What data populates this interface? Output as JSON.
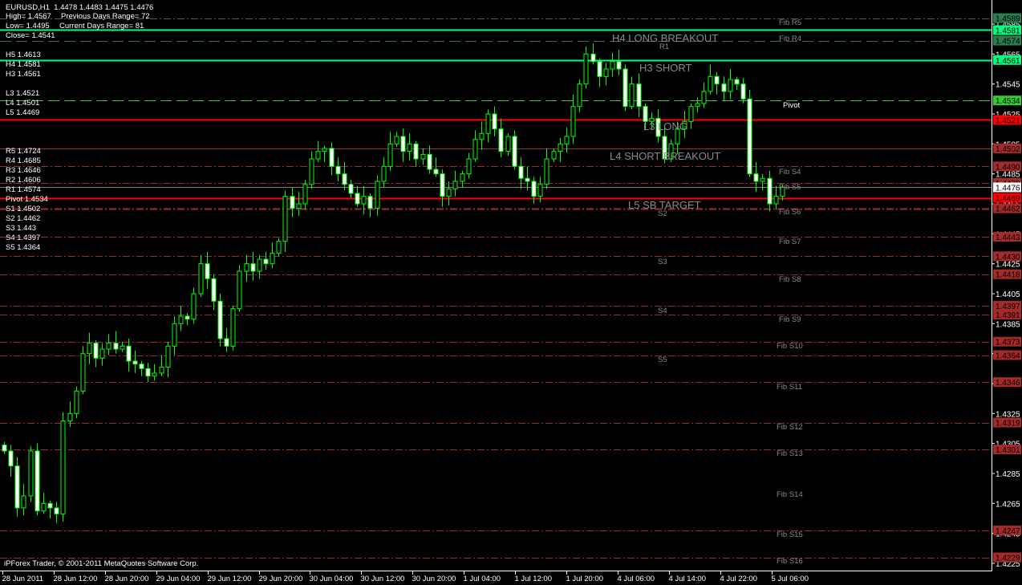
{
  "header": {
    "symbol_line": "EURUSD,H1  1.4478 1.4483 1.4475 1.4476",
    "high": "High= 1.4567",
    "prev_range": "Previous Days Range= 72",
    "low": "Low= 1.4495",
    "curr_range": "Current Days Range= 81",
    "close": "Close= 1.4541"
  },
  "levels_info": [
    "H5 1.4613",
    "H4 1.4581",
    "H3 1.4561",
    "L3 1.4521",
    "L4 1.4501",
    "L5 1.4469",
    "R5 1.4724",
    "R4 1.4685",
    "R3 1.4646",
    "R2 1.4606",
    "R1 1.4574",
    "Pivot 1.4534",
    "S1 1.4502",
    "S2 1.4462",
    "S3 1.443",
    "S4 1.4397",
    "S5 1.4364"
  ],
  "chart_labels": {
    "fib_r5": "Fib R5",
    "fib_r4": "Fib R4",
    "h4": "H4 LONG BREAKOUT",
    "r1": "R1",
    "h3": "H3 SHORT",
    "pivot": "Pivot",
    "l3": "L3 LONG",
    "l4": "L4 SHORT BREAKOUT",
    "fib_s4": "Fib S4",
    "fib_s5": "Fib S5",
    "l5": "L5 SB TARGET",
    "s2": "S2",
    "fib_s6": "Fib S6",
    "fib_s7": "Fib S7",
    "s3": "S3",
    "fib_s8": "Fib S8",
    "s4": "S4",
    "fib_s9": "Fib S9",
    "fib_s10": "Fib S10",
    "s5": "S5",
    "fib_s11": "Fib S11",
    "fib_s12": "Fib S12",
    "fib_s13": "Fib S13",
    "fib_s14": "Fib S14",
    "fib_s15": "Fib S15",
    "fib_s16": "Fib S16"
  },
  "copyright": "iPForex Trader, © 2001-2011 MetaQuotes Software Corp.",
  "chart_data": {
    "type": "candlestick",
    "symbol": "EURUSD",
    "timeframe": "H1",
    "ylim": [
      1.422,
      1.46
    ],
    "y_ticks": [
      "1.4585",
      "1.4565",
      "1.4545",
      "1.4525",
      "1.4505",
      "1.4485",
      "1.4465",
      "1.4445",
      "1.4425",
      "1.4405",
      "1.4385",
      "1.4365",
      "1.4345",
      "1.4325",
      "1.4305",
      "1.4285",
      "1.4265",
      "1.4245",
      "1.4225"
    ],
    "x_ticks": [
      "28 Jun 2011",
      "28 Jun 12:00",
      "28 Jun 20:00",
      "29 Jun 04:00",
      "29 Jun 12:00",
      "29 Jun 20:00",
      "30 Jun 04:00",
      "30 Jun 12:00",
      "30 Jun 20:00",
      "1 Jul 04:00",
      "1 Jul 12:00",
      "1 Jul 20:00",
      "4 Jul 06:00",
      "4 Jul 14:00",
      "4 Jul 22:00",
      "5 Jul 06:00"
    ],
    "closes": [
      1.43,
      1.429,
      1.4262,
      1.427,
      1.43,
      1.426,
      1.4265,
      1.4262,
      1.4258,
      1.432,
      1.4325,
      1.434,
      1.4365,
      1.4372,
      1.4362,
      1.4368,
      1.4372,
      1.4368,
      1.437,
      1.436,
      1.4358,
      1.4355,
      1.435,
      1.4352,
      1.4356,
      1.437,
      1.4385,
      1.439,
      1.4388,
      1.4405,
      1.4425,
      1.4415,
      1.44,
      1.4375,
      1.437,
      1.4395,
      1.442,
      1.4425,
      1.442,
      1.4428,
      1.4425,
      1.4432,
      1.444,
      1.447,
      1.4462,
      1.4465,
      1.4478,
      1.4495,
      1.45,
      1.4502,
      1.449,
      1.4485,
      1.4478,
      1.4472,
      1.4465,
      1.447,
      1.4462,
      1.448,
      1.449,
      1.4505,
      1.451,
      1.45,
      1.4505,
      1.4495,
      1.4498,
      1.4488,
      1.4485,
      1.447,
      1.4475,
      1.448,
      1.4485,
      1.4495,
      1.4508,
      1.4512,
      1.4525,
      1.4515,
      1.45,
      1.451,
      1.449,
      1.4482,
      1.448,
      1.447,
      1.4478,
      1.4495,
      1.45,
      1.4505,
      1.451,
      1.453,
      1.4545,
      1.4565,
      1.456,
      1.455,
      1.4555,
      1.456,
      1.4555,
      1.453,
      1.4545,
      1.453,
      1.452,
      1.4522,
      1.451,
      1.4495,
      1.4505,
      1.4515,
      1.452,
      1.453,
      1.4532,
      1.454,
      1.455,
      1.4545,
      1.454,
      1.4548,
      1.4545,
      1.4535,
      1.4485,
      1.448,
      1.4482,
      1.4465,
      1.447,
      1.4476
    ],
    "current_price": "1.4476",
    "levels": [
      {
        "price": "1.4589",
        "style": "dashdot",
        "color": "#3a6a4a",
        "label_bg": "#2e7d4f"
      },
      {
        "price": "1.4581",
        "style": "solid",
        "color": "#00ff7f",
        "label_bg": "#00ff7f",
        "width": 2
      },
      {
        "price": "1.4574",
        "style": "dashed",
        "color": "#3a6a4a",
        "label_bg": "#2e7d4f"
      },
      {
        "price": "1.4561",
        "style": "solid",
        "color": "#00ff7f",
        "label_bg": "#00ff7f",
        "width": 2
      },
      {
        "price": "1.4534",
        "style": "dashed",
        "color": "#32cd32",
        "label_bg": "#32cd32"
      },
      {
        "price": "1.4521",
        "style": "solid",
        "color": "#ff0000",
        "label_bg": "#ff0000",
        "width": 2
      },
      {
        "price": "1.4502",
        "style": "solid",
        "color": "#a52a2a",
        "label_bg": "#a52a2a"
      },
      {
        "price": "1.4490",
        "style": "dashdot",
        "color": "#a52a2a",
        "label_bg": "#a52a2a"
      },
      {
        "price": "1.4479",
        "style": "dashdot",
        "color": "#a52a2a",
        "label_bg": "#a52a2a"
      },
      {
        "price": "1.4476",
        "style": "solid",
        "color": "#808080",
        "label_bg": "#ffffff"
      },
      {
        "price": "1.4469",
        "style": "solid",
        "color": "#ff0000",
        "label_bg": "#ff0000",
        "width": 2
      },
      {
        "price": "1.4462",
        "style": "dashdot",
        "color": "#a52a2a",
        "label_bg": "#a52a2a",
        "width": 2
      },
      {
        "price": "1.4443",
        "style": "dashdot",
        "color": "#a52a2a",
        "label_bg": "#a52a2a"
      },
      {
        "price": "1.4430",
        "style": "dashdot",
        "color": "#a52a2a",
        "label_bg": "#a52a2a"
      },
      {
        "price": "1.4418",
        "style": "dashdot",
        "color": "#a52a2a",
        "label_bg": "#a52a2a"
      },
      {
        "price": "1.4397",
        "style": "dashdot",
        "color": "#a52a2a",
        "label_bg": "#a52a2a"
      },
      {
        "price": "1.4391",
        "style": "dashdot",
        "color": "#a52a2a",
        "label_bg": "#a52a2a"
      },
      {
        "price": "1.4373",
        "style": "dashdot",
        "color": "#a52a2a",
        "label_bg": "#a52a2a"
      },
      {
        "price": "1.4364",
        "style": "dashdot",
        "color": "#a52a2a",
        "label_bg": "#a52a2a"
      },
      {
        "price": "1.4346",
        "style": "dashdot",
        "color": "#a52a2a",
        "label_bg": "#a52a2a"
      },
      {
        "price": "1.4319",
        "style": "dashdot",
        "color": "#a52a2a",
        "label_bg": "#a52a2a"
      },
      {
        "price": "1.4301",
        "style": "dashdot",
        "color": "#a52a2a",
        "label_bg": "#a52a2a"
      },
      {
        "price": "1.4247",
        "style": "dashdot",
        "color": "#a52a2a",
        "label_bg": "#a52a2a"
      },
      {
        "price": "1.4229",
        "style": "dashdot",
        "color": "#a52a2a",
        "label_bg": "#a52a2a"
      }
    ]
  },
  "colors": {
    "background": "#000000",
    "bull_outline": "#00ff00",
    "bear_fill": "#ffffff",
    "wick": "#00ff00",
    "text": "#ffffff",
    "label_gray": "#8a8a8a"
  }
}
